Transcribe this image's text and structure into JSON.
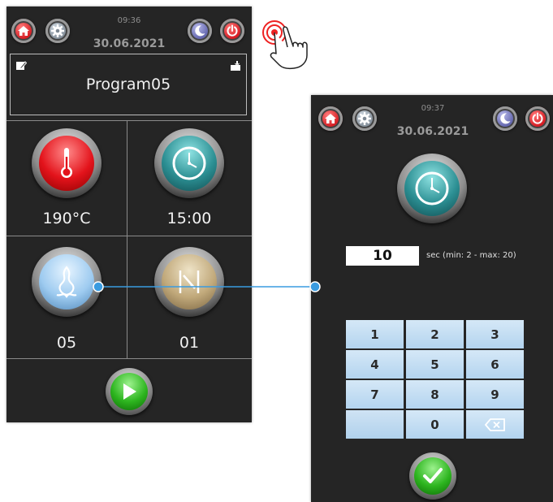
{
  "colors": {
    "panel_bg": "#252525",
    "accent_blue": "#3a9be0",
    "red": "#d1121a",
    "green": "#2db51f",
    "keypad": "#c4def3"
  },
  "left_screen": {
    "header": {
      "time": "09:36",
      "date": "30.06.2021",
      "icons": [
        "home-icon",
        "gear-icon",
        "moon-icon",
        "power-icon"
      ]
    },
    "program": {
      "name": "Program05",
      "icons": [
        "edit-icon",
        "save-icon"
      ]
    },
    "tiles": [
      {
        "icon": "thermometer-icon",
        "value": "190°C"
      },
      {
        "icon": "clock-icon",
        "value": "15:00"
      },
      {
        "icon": "steam-icon",
        "value": "05"
      },
      {
        "icon": "vent-icon",
        "value": "01"
      }
    ],
    "start_icon": "play-icon"
  },
  "right_screen": {
    "header": {
      "time": "09:37",
      "date": "30.06.2021",
      "icons": [
        "home-icon",
        "gear-icon",
        "moon-icon",
        "power-icon"
      ]
    },
    "clock_icon": "clock-icon",
    "value": "10",
    "range_text": "sec (min: 2 - max: 20)",
    "keypad": [
      "1",
      "2",
      "3",
      "4",
      "5",
      "6",
      "7",
      "8",
      "9",
      "",
      "0",
      "backspace"
    ],
    "confirm_icon": "checkmark-icon"
  },
  "annotations": {
    "tap_icon": "hand-tap-icon"
  }
}
